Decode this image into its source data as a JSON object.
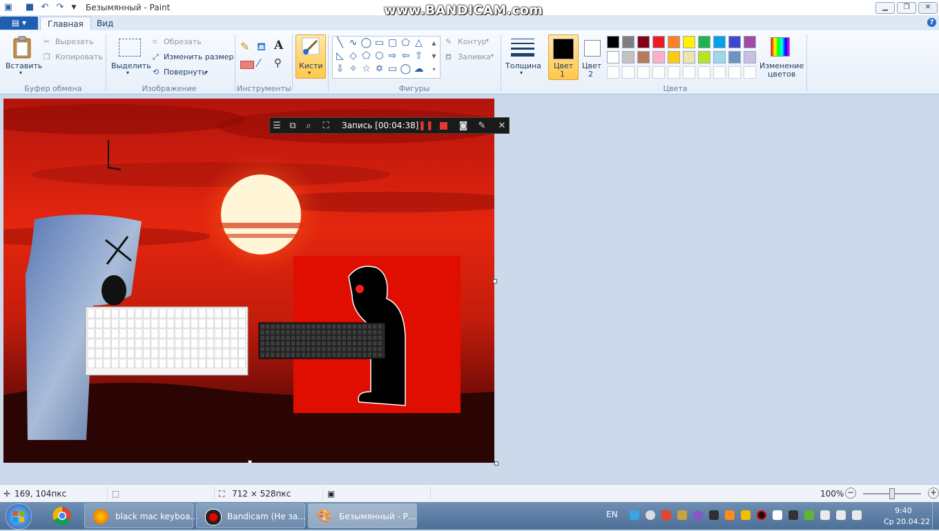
{
  "window": {
    "title": "Безымянный - Paint",
    "watermark": "www.BANDICAM.com",
    "min": "▁",
    "max": "❐",
    "close": "✕"
  },
  "tabs": {
    "file": "▤ ▾",
    "home": "Главная",
    "view": "Вид",
    "help": "?"
  },
  "ribbon": {
    "clipboard": {
      "paste": "Вставить",
      "cut": "Вырезать",
      "copy": "Копировать",
      "label": "Буфер обмена"
    },
    "image": {
      "select": "Выделить",
      "crop": "Обрезать",
      "resize": "Изменить размер",
      "rotate": "Повернуть",
      "label": "Изображение"
    },
    "tools": {
      "label": "Инструменты",
      "text_icon": "A"
    },
    "brushes": {
      "label": "Кисти"
    },
    "shapes": {
      "outline": "Контур",
      "fill": "Заливка",
      "label": "Фигуры"
    },
    "size": {
      "label": "Толщина"
    },
    "color1": {
      "label1": "Цвет",
      "label2": "1"
    },
    "color2": {
      "label1": "Цвет",
      "label2": "2"
    },
    "colors": {
      "label": "Цвета",
      "row1": [
        "#000000",
        "#7f7f7f",
        "#880015",
        "#ed1c24",
        "#ff7f27",
        "#fff200",
        "#22b14c",
        "#00a2e8",
        "#3f48cc",
        "#a349a4"
      ],
      "row2": [
        "#ffffff",
        "#c3c3c3",
        "#b97a57",
        "#ffaec9",
        "#ffc90e",
        "#efe4b0",
        "#b5e61d",
        "#99d9ea",
        "#7092be",
        "#c8bfe7"
      ],
      "row3": [
        "#ffffff",
        "#ffffff",
        "#ffffff",
        "#ffffff",
        "#ffffff",
        "#ffffff",
        "#ffffff",
        "#ffffff",
        "#ffffff",
        "#ffffff"
      ]
    },
    "edit_colors": {
      "line1": "Изменение",
      "line2": "цветов"
    }
  },
  "bandicam": {
    "recording": "Запись [00:04:38]"
  },
  "status": {
    "cursor_pos": "169, 104пкс",
    "image_size": "712 × 528пкс",
    "zoom": "100%"
  },
  "taskbar": {
    "firefox": "black mac keyboa...",
    "bandicam": "Bandicam (Не за...",
    "paint": "Безымянный - Р...",
    "lang": "EN",
    "time": "9:40",
    "date": "Ср 20.04.22"
  }
}
